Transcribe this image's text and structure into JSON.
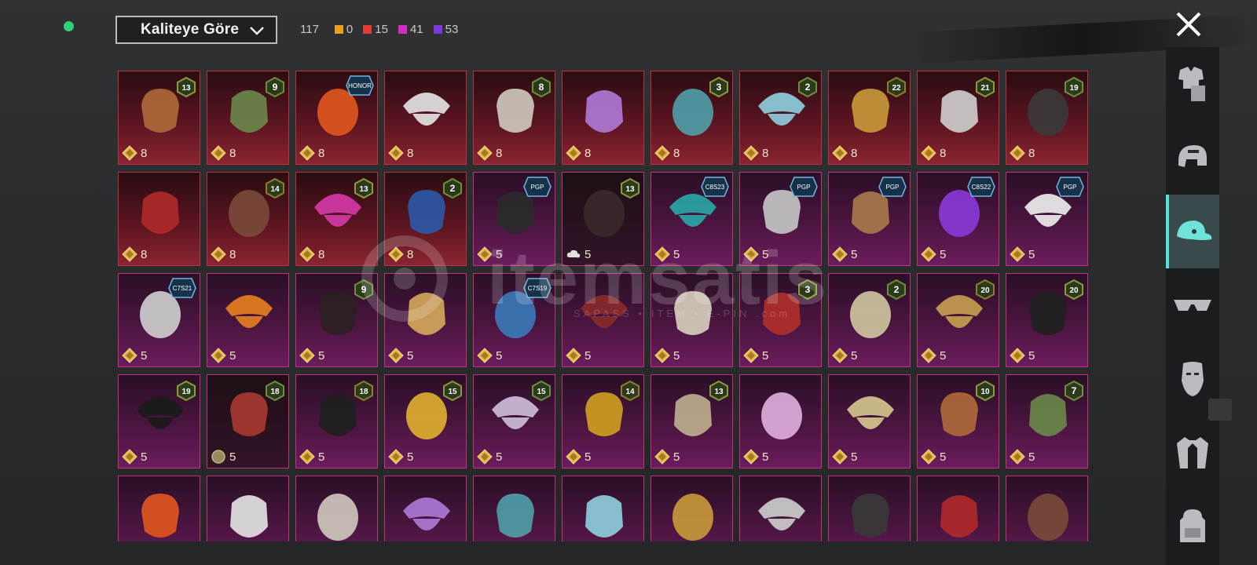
{
  "sort": {
    "label": "Kaliteye Göre"
  },
  "counts": {
    "total": "117",
    "items": [
      {
        "color": "#e8a021",
        "value": "0"
      },
      {
        "color": "#e53a3a",
        "value": "15"
      },
      {
        "color": "#d22ec2",
        "value": "41"
      },
      {
        "color": "#7a3bd9",
        "value": "53"
      }
    ]
  },
  "watermark": {
    "text": "itemsatis",
    "sub": "SAPASS • ITEM • E-PIN .com"
  },
  "sidebar": {
    "items": [
      {
        "icon": "outfit-icon"
      },
      {
        "icon": "helmet-icon"
      },
      {
        "icon": "cap-icon",
        "active": true
      },
      {
        "icon": "glasses-icon"
      },
      {
        "icon": "face-mask-icon"
      },
      {
        "icon": "jacket-icon"
      },
      {
        "icon": "backpack-icon"
      }
    ]
  },
  "grid": {
    "rows": [
      [
        {
          "cost": "8",
          "badge": "13",
          "theme": "red"
        },
        {
          "cost": "8",
          "badge": "9",
          "theme": "red"
        },
        {
          "cost": "8",
          "tag": "HONOR",
          "theme": "red"
        },
        {
          "cost": "8",
          "theme": "red"
        },
        {
          "cost": "8",
          "badge": "8",
          "theme": "red"
        },
        {
          "cost": "8",
          "theme": "red"
        },
        {
          "cost": "8",
          "badge": "3",
          "theme": "red"
        },
        {
          "cost": "8",
          "badge": "2",
          "theme": "red"
        },
        {
          "cost": "8",
          "badge": "22",
          "theme": "red"
        },
        {
          "cost": "8",
          "badge": "21",
          "theme": "red"
        },
        {
          "cost": "8",
          "badge": "19",
          "theme": "red"
        }
      ],
      [
        {
          "cost": "8",
          "theme": "red"
        },
        {
          "cost": "8",
          "badge": "14",
          "theme": "red"
        },
        {
          "cost": "8",
          "badge": "13",
          "theme": "red"
        },
        {
          "cost": "8",
          "badge": "2",
          "theme": "red"
        },
        {
          "cost": "5",
          "tag": "PGP",
          "theme": "purple"
        },
        {
          "cost": "5",
          "badge": "13",
          "theme": "dark",
          "cloud": true
        },
        {
          "cost": "5",
          "tag": "C8S23",
          "theme": "purple"
        },
        {
          "cost": "5",
          "tag": "PGP",
          "theme": "purple"
        },
        {
          "cost": "5",
          "tag": "PGP",
          "theme": "purple"
        },
        {
          "cost": "5",
          "tag": "C8S22",
          "theme": "purple"
        },
        {
          "cost": "5",
          "tag": "PGP",
          "theme": "purple"
        }
      ],
      [
        {
          "cost": "5",
          "tag": "C7S21",
          "theme": "purple"
        },
        {
          "cost": "5",
          "theme": "purple"
        },
        {
          "cost": "5",
          "badge": "9",
          "theme": "purple"
        },
        {
          "cost": "5",
          "theme": "purple"
        },
        {
          "cost": "5",
          "tag": "C7S19",
          "theme": "purple"
        },
        {
          "cost": "5",
          "theme": "purple"
        },
        {
          "cost": "5",
          "theme": "purple"
        },
        {
          "cost": "5",
          "badge": "3",
          "theme": "purple"
        },
        {
          "cost": "5",
          "badge": "2",
          "theme": "purple"
        },
        {
          "cost": "5",
          "badge": "20",
          "theme": "purple"
        },
        {
          "cost": "5",
          "badge": "20",
          "theme": "purple"
        }
      ],
      [
        {
          "cost": "5",
          "badge": "19",
          "theme": "purple"
        },
        {
          "cost": "5",
          "badge": "18",
          "theme": "dark",
          "coin": true
        },
        {
          "cost": "5",
          "badge": "18",
          "theme": "purple"
        },
        {
          "cost": "5",
          "badge": "15",
          "theme": "purple"
        },
        {
          "cost": "5",
          "badge": "15",
          "theme": "purple"
        },
        {
          "cost": "5",
          "badge": "14",
          "theme": "purple"
        },
        {
          "cost": "5",
          "badge": "13",
          "theme": "purple"
        },
        {
          "cost": "5",
          "theme": "purple"
        },
        {
          "cost": "5",
          "theme": "purple"
        },
        {
          "cost": "5",
          "badge": "10",
          "theme": "purple"
        },
        {
          "cost": "5",
          "badge": "7",
          "theme": "purple"
        }
      ],
      [
        {
          "theme": "purple"
        },
        {
          "theme": "purple"
        },
        {
          "theme": "purple"
        },
        {
          "theme": "purple"
        },
        {
          "theme": "purple"
        },
        {
          "theme": "purple"
        },
        {
          "theme": "purple"
        },
        {
          "theme": "purple"
        },
        {
          "theme": "purple"
        },
        {
          "theme": "purple"
        },
        {
          "theme": "purple"
        }
      ]
    ]
  }
}
